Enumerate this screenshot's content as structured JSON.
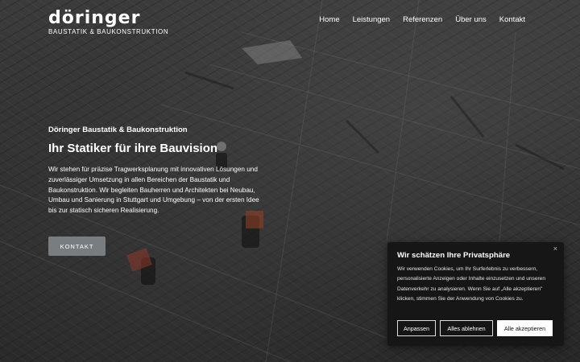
{
  "brand": {
    "wordmark": "döringer",
    "tagline": "BAUSTATIK & BAUKONSTRUKTION"
  },
  "nav": {
    "items": [
      {
        "label": "Home"
      },
      {
        "label": "Leistungen"
      },
      {
        "label": "Referenzen"
      },
      {
        "label": "Über uns"
      },
      {
        "label": "Kontakt"
      }
    ]
  },
  "hero": {
    "eyebrow": "Döringer Baustatik & Baukonstruktion",
    "headline": "Ihr Statiker für ihre Bauvision",
    "intro": "Wir stehen für präzise Tragwerksplanung mit innovativen Lösungen und zuverlässiger Umsetzung in allen Bereichen der Baustatik und Baukonstruktion. Wir begleiten Bauherren und Architekten bei Neubau, Umbau und Sanierung in Stuttgart und Umgebung – von der ersten Idee bis zur statisch sicheren Realisierung.",
    "cta_label": "KONTAKT"
  },
  "cookie_banner": {
    "close_icon": "×",
    "title": "Wir schätzen Ihre Privatsphäre",
    "text": "Wir verwenden Cookies, um Ihr Surferlebnis zu verbessern, personalisierte Anzeigen oder Inhalte einzusetzen und unseren Datenverkehr zu analysieren. Wenn Sie auf „Alle akzeptieren\" klicken, stimmen Sie der Anwendung von Cookies zu.",
    "buttons": {
      "customize": "Anpassen",
      "reject": "Alles ablehnen",
      "accept": "Alle akzeptieren"
    }
  },
  "colors": {
    "cta_bg": "#7a7d80",
    "banner_bg": "#161616",
    "text": "#ffffff"
  }
}
